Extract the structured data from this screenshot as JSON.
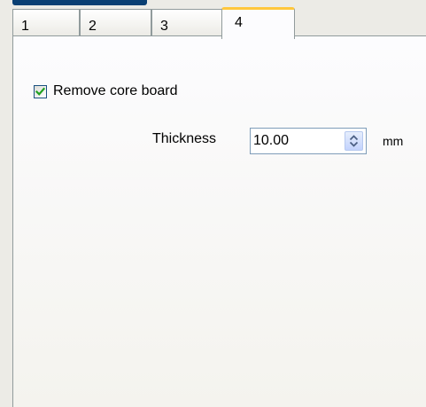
{
  "tabs": [
    {
      "label": "1",
      "active": false
    },
    {
      "label": "2",
      "active": false
    },
    {
      "label": "3",
      "active": false
    },
    {
      "label": "4",
      "active": true
    }
  ],
  "remove_core_board": {
    "label": "Remove core board",
    "checked": true
  },
  "thickness": {
    "label": "Thickness",
    "value": "10.00",
    "unit": "mm"
  },
  "colors": {
    "tab_active_accent": "#ffc73c",
    "check_mark": "#21a121",
    "border": "#919b9c"
  },
  "icons": {
    "check": "check-icon",
    "spinner": "spinner-arrows-icon"
  }
}
